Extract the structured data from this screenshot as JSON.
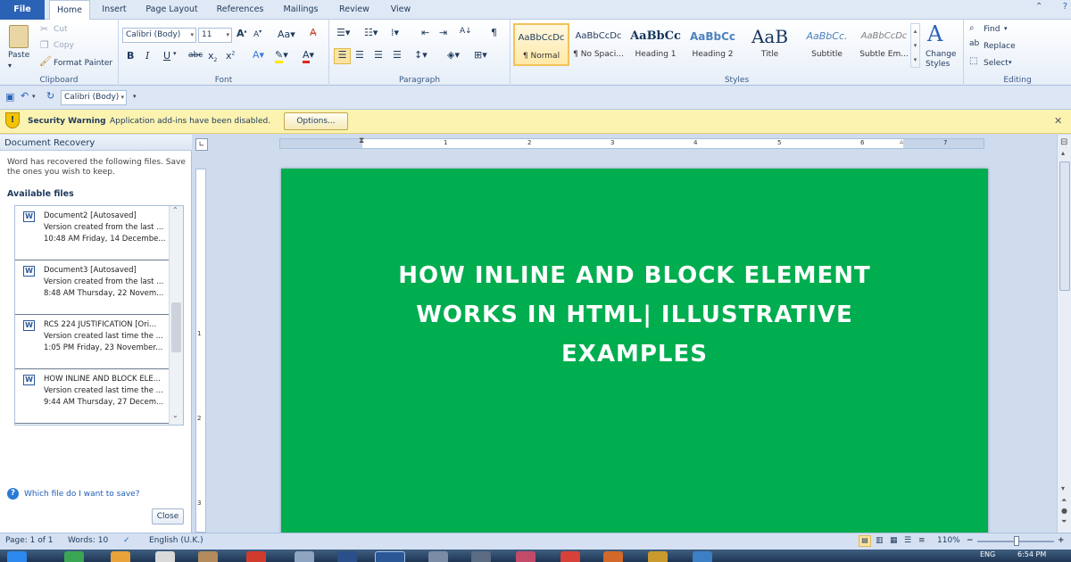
{
  "tabs": {
    "file": "File",
    "home": "Home",
    "insert": "Insert",
    "page_layout": "Page Layout",
    "references": "References",
    "mailings": "Mailings",
    "review": "Review",
    "view": "View"
  },
  "clipboard": {
    "paste": "Paste",
    "cut": "Cut",
    "copy": "Copy",
    "format_painter": "Format Painter",
    "label": "Clipboard"
  },
  "font": {
    "name": "Calibri (Body)",
    "size": "11",
    "label": "Font"
  },
  "paragraph": {
    "label": "Paragraph"
  },
  "styles": {
    "label": "Styles",
    "items": [
      {
        "sample": "AaBbCcDc",
        "name": "¶ Normal"
      },
      {
        "sample": "AaBbCcDc",
        "name": "¶ No Spaci..."
      },
      {
        "sample": "AaBbCc",
        "name": "Heading 1"
      },
      {
        "sample": "AaBbCc",
        "name": "Heading 2"
      },
      {
        "sample": "AaB",
        "name": "Title"
      },
      {
        "sample": "AaBbCc.",
        "name": "Subtitle"
      },
      {
        "sample": "AaBbCcDc",
        "name": "Subtle Em..."
      }
    ],
    "change_styles_1": "Change",
    "change_styles_2": "Styles"
  },
  "editing": {
    "find": "Find",
    "replace": "Replace",
    "select": "Select",
    "label": "Editing"
  },
  "qat": {
    "font": "Calibri (Body)"
  },
  "security": {
    "title": "Security Warning",
    "message": "Application add-ins have been disabled.",
    "options": "Options..."
  },
  "recovery": {
    "title": "Document Recovery",
    "desc_1": "Word has recovered the following files.  Save",
    "desc_2": "the ones you wish to keep.",
    "available": "Available files",
    "files": [
      {
        "name": "Document2  [Autosaved]",
        "version": "Version created from the last ...",
        "time": "10:48 AM Friday, 14 Decembe..."
      },
      {
        "name": "Document3  [Autosaved]",
        "version": "Version created from the last ...",
        "time": "8:48 AM Thursday, 22 Novem..."
      },
      {
        "name": "RCS 224 JUSTIFICATION  [Ori...",
        "version": "Version created last time the ...",
        "time": "1:05 PM Friday, 23 November..."
      },
      {
        "name": "HOW  INLINE AND BLOCK ELE...",
        "version": "Version created last time the ...",
        "time": "9:44 AM Thursday, 27 Decem..."
      }
    ],
    "help": "Which file do I want to save?",
    "close": "Close"
  },
  "document": {
    "line1": "HOW INLINE AND BLOCK ELEMENT",
    "line2": "WORKS IN HTML| ILLUSTRATIVE",
    "line3": "EXAMPLES"
  },
  "ruler": {
    "ticks": [
      "1",
      "2",
      "3",
      "4",
      "5",
      "6",
      "7"
    ],
    "vticks": [
      "1",
      "2",
      "3"
    ]
  },
  "status": {
    "page": "Page: 1 of 1",
    "words": "Words: 10",
    "language": "English (U.K.)",
    "zoom": "110%"
  },
  "taskbar": {
    "lang": "ENG",
    "time": "6:54 PM"
  },
  "colors": {
    "page_fill": "#00ad4f",
    "file_tab": "#2a62b6",
    "warning_bar": "#fcf3b1"
  }
}
